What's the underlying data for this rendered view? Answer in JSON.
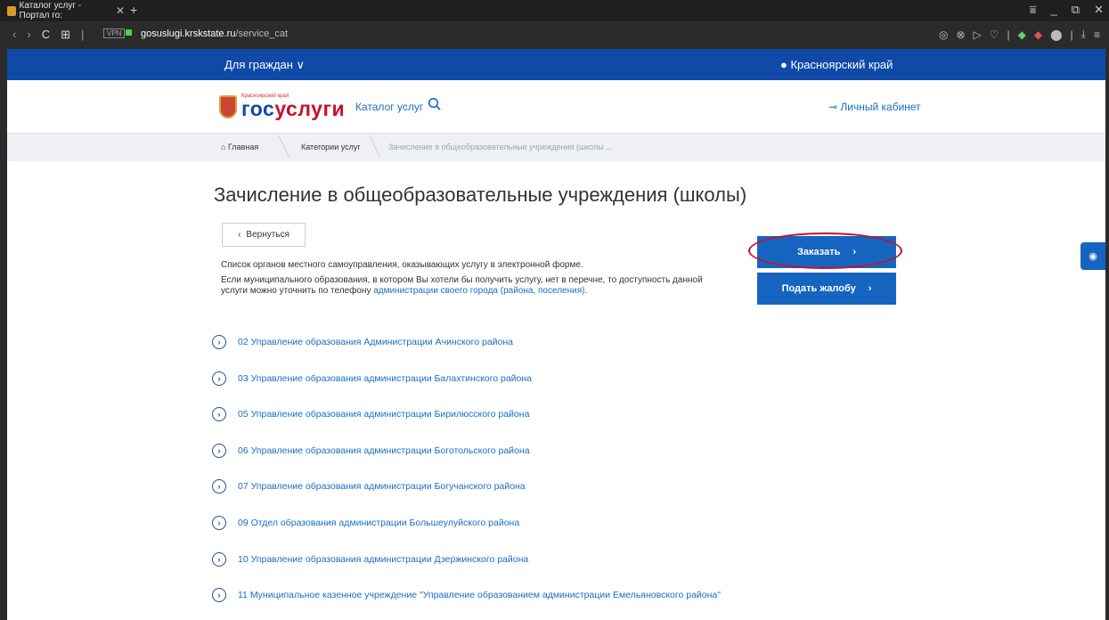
{
  "browser": {
    "tab_title": "Каталог услуг - Портал го:",
    "tab_close": "✕",
    "new_tab": "+",
    "window_controls": [
      "⩸",
      "_",
      "⧉",
      "✕"
    ],
    "nav": [
      "‹",
      "›",
      "C",
      "⊞",
      "|"
    ],
    "vpn_label": "VPN",
    "url_domain": "gosuslugi.krskstate.ru",
    "url_path": "/service_cat",
    "extension_icons": [
      "◎",
      "⊗",
      "▷",
      "♡",
      "|",
      "◆",
      "◆",
      "⬤",
      "|",
      "⤓",
      "≡"
    ]
  },
  "site_top": {
    "for_citizens": "Для граждан ∨",
    "region": "Красноярский край"
  },
  "header": {
    "logo_small": "Красноярский край",
    "logo_part1": "гос",
    "logo_part2": "услуги",
    "catalog_link": "Каталог услуг",
    "cabinet_link": "Личный кабинет"
  },
  "breadcrumbs": {
    "home": "Главная",
    "categories": "Категории услуг",
    "current": "Зачисление в общеобразовательные учреждения (школы ..."
  },
  "main": {
    "title": "Зачисление в общеобразовательные учреждения (школы)",
    "back_label": "Вернуться",
    "desc1": "Список органов местного самоуправления, оказывающих услугу в электронной форме.",
    "desc2_text": "Если муниципального образования, в котором Вы хотели бы получить услугу, нет в перечне, то доступность данной услуги можно уточнить по телефону",
    "desc2_link": "администрации своего города (района, поселения)",
    "desc2_end": ".",
    "order_button": "Заказать",
    "complaint_button": "Подать жалобу"
  },
  "list_items": [
    "02 Управление образования Администрации Ачинского района",
    "03 Управление образования администрации Балахтинского района",
    "05 Управление образования администрации Бирилюсского района",
    "06 Управление образования администрации Боготольского района",
    "07 Управление образования администрации Богучанского района",
    "09 Отдел образования администрации Большеулуйского района",
    "10 Управление образования администрации Дзержинского района",
    "11 Муниципальное казенное учреждение \"Управление образованием администрации Емельяновского района\""
  ],
  "colors": {
    "top_bar": "#0f4aa8",
    "button_blue": "#1565c0",
    "link": "#1a6ec2",
    "highlight_ellipse": "#c8102e"
  },
  "icons": {
    "home": "home-icon",
    "location": "location-pin-icon",
    "search": "search-icon",
    "key": "key-icon",
    "eye": "eye-icon",
    "chevron": "chevron-right-icon",
    "list_arrow": "circle-arrow-right-icon"
  }
}
